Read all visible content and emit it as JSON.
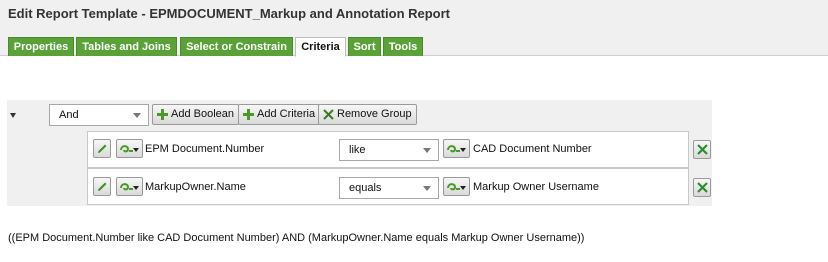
{
  "header": {
    "title": "Edit Report Template - EPMDOCUMENT_Markup and Annotation Report"
  },
  "tabs": [
    {
      "label": "Properties",
      "active": false
    },
    {
      "label": "Tables and Joins",
      "active": false
    },
    {
      "label": "Select or Constrain",
      "active": false
    },
    {
      "label": "Criteria",
      "active": true
    },
    {
      "label": "Sort",
      "active": false
    },
    {
      "label": "Tools",
      "active": false
    }
  ],
  "group": {
    "operator": "And",
    "buttons": {
      "add_boolean": "Add Boolean",
      "add_criteria": "Add Criteria",
      "remove_group": "Remove Group"
    }
  },
  "criteria": [
    {
      "attribute": "EPM Document.Number",
      "operator": "like",
      "value": "CAD Document Number"
    },
    {
      "attribute": "MarkupOwner.Name",
      "operator": "equals",
      "value": "Markup Owner Username"
    }
  ],
  "expression": "((EPM Document.Number like CAD Document Number) AND (MarkupOwner.Name equals Markup Owner Username))",
  "colors": {
    "tab_green": "#5aa238",
    "icon_green": "#4a9a2a",
    "remove_green": "#2e8b2e",
    "panel_gray": "#f0f0f0"
  },
  "icons": [
    "pencil-icon",
    "swirl-icon",
    "plus-icon",
    "x-icon"
  ]
}
